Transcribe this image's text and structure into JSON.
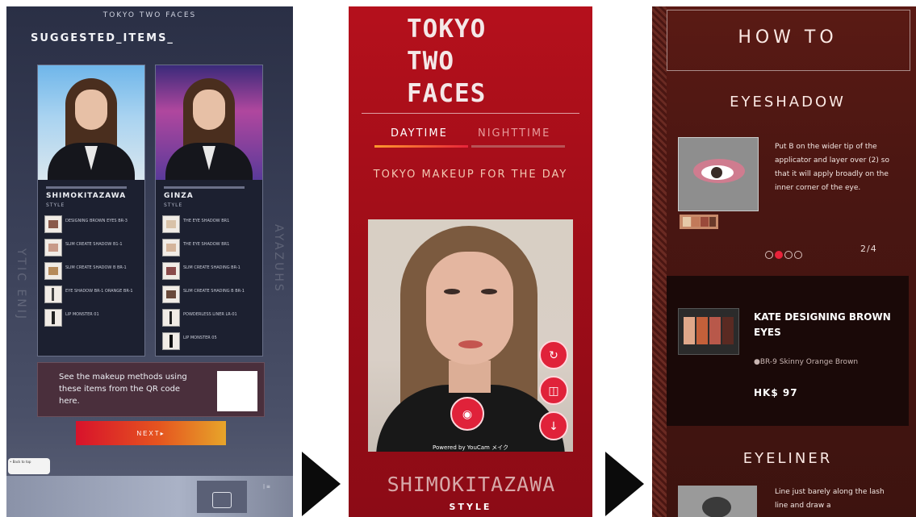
{
  "panel1": {
    "top_label": "TOKYO TWO FACES",
    "heading": "SUGGESTED_ITEMS_",
    "side_left": "YTIC ENIJ",
    "side_right": "AYAZUHS",
    "cards": [
      {
        "name": "SHIMOKITAZAWA",
        "style": "STYLE",
        "items": [
          "DESIGNING BROWN EYES BR-3",
          "SLIM CREATE SHADOW B1-1",
          "SLIM CREATE SHADOW B BR-1",
          "EYE SHADOW BR-1 ORANGE BR-1",
          "LIP MONSTER 01"
        ]
      },
      {
        "name": "GINZA",
        "style": "STYLE",
        "items": [
          "THE EYE SHADOW BR1",
          "THE EYE SHADOW BR1",
          "SLIM CREATE SHADING BR-1",
          "SLIM CREATE SHADING B BR-1",
          "POWDERLESS LINER LR-01",
          "LIP MONSTER 05"
        ]
      }
    ],
    "qr_text": "See the makeup methods using these items from the QR code here.",
    "next_label": "NEXT▸",
    "badge": "• Back to top"
  },
  "panel2": {
    "title_line1": "TOKYO",
    "title_line2": "TWO",
    "title_line3": "FACES",
    "tab_day": "DAYTIME",
    "tab_night": "NIGHTTIME",
    "subtitle": "TOKYO MAKEUP FOR THE DAY",
    "powered_by": "Powered by YouCam メイク",
    "style_name": "SHIMOKITAZAWA",
    "style_sub": "STYLE"
  },
  "panel3": {
    "how_to": "HOW TO",
    "section1": "EYESHADOW",
    "step_text": "Put B on the wider tip of the applicator and layer over (2) so that it will apply broadly on the inner corner of the eye.",
    "pager": "2/4",
    "product_brand": "KATE DESIGNING BROWN EYES",
    "product_shade": "●BR-9 Skinny Orange Brown",
    "product_price": "HK$ 97",
    "section2": "EYELINER",
    "step2_text": "Line just barely along the lash line and draw a"
  },
  "colors": {
    "kiosk_bg": "#2a2f45",
    "brand_red": "#b5101c",
    "accent_red": "#e0223a",
    "howto_bg": "#4a1612"
  }
}
